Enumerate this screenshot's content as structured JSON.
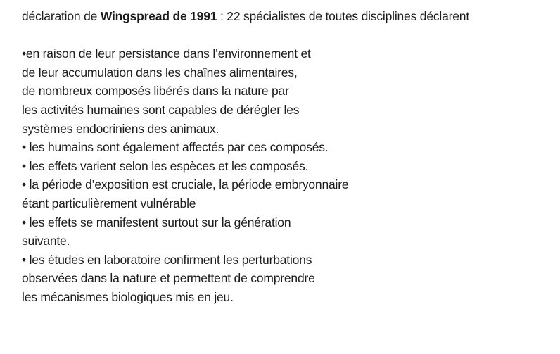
{
  "heading": {
    "prefix": "déclaration de ",
    "bold": "Wingspread de 1991",
    "suffix": " : 22 spécialistes de toutes disciplines déclarent"
  },
  "lines": [
    "•en raison de leur persistance dans l’environnement et",
    "de leur accumulation dans les chaînes alimentaires,",
    "de nombreux composés libérés dans la nature par",
    "les activités humaines sont capables de dérégler les",
    "systèmes endocriniens des animaux.",
    "• les humains sont également affectés par ces composés.",
    "• les effets varient selon les espèces et les composés.",
    "• la période d’exposition est cruciale, la période embryonnaire",
    "étant particulièrement vulnérable",
    "• les effets se manifestent surtout sur la génération",
    "suivante.",
    "• les études en laboratoire confirment les perturbations",
    "observées dans la nature et permettent de comprendre",
    "les mécanismes biologiques mis en jeu."
  ]
}
